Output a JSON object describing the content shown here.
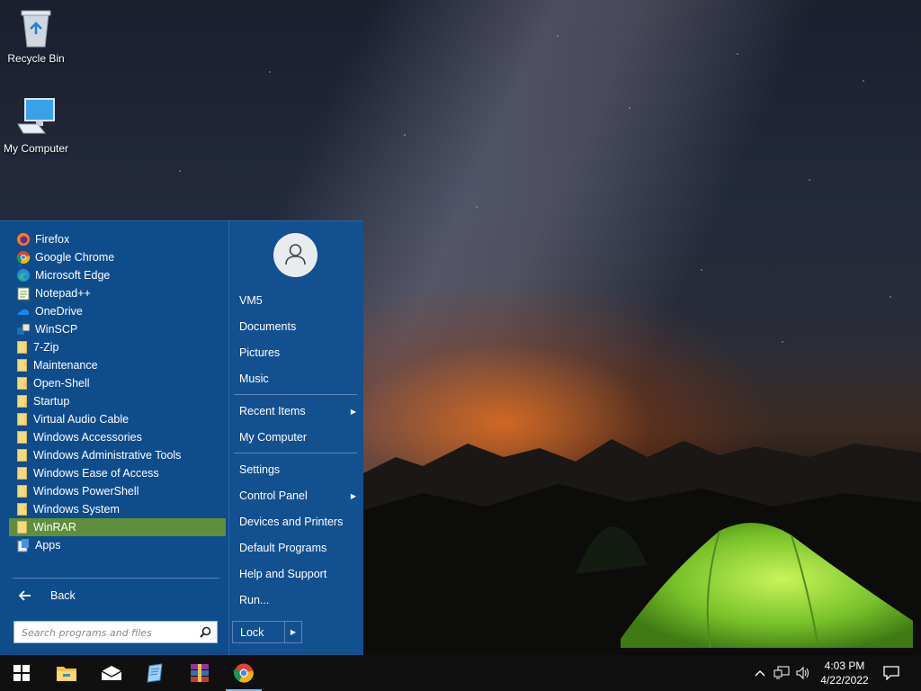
{
  "desktop": {
    "icons": [
      {
        "label": "Recycle Bin",
        "icon": "recycle-bin-icon"
      },
      {
        "label": "My Computer",
        "icon": "computer-icon"
      }
    ]
  },
  "start_menu": {
    "programs": [
      {
        "label": "Firefox",
        "icon": "firefox-icon"
      },
      {
        "label": "Google Chrome",
        "icon": "chrome-icon"
      },
      {
        "label": "Microsoft Edge",
        "icon": "edge-icon"
      },
      {
        "label": "Notepad++",
        "icon": "notepadpp-icon"
      },
      {
        "label": "OneDrive",
        "icon": "onedrive-icon"
      },
      {
        "label": "WinSCP",
        "icon": "winscp-icon"
      },
      {
        "label": "7-Zip",
        "icon": "folder-icon"
      },
      {
        "label": "Maintenance",
        "icon": "folder-icon"
      },
      {
        "label": "Open-Shell",
        "icon": "folder-icon"
      },
      {
        "label": "Startup",
        "icon": "folder-icon"
      },
      {
        "label": "Virtual Audio Cable",
        "icon": "folder-icon"
      },
      {
        "label": "Windows Accessories",
        "icon": "folder-icon"
      },
      {
        "label": "Windows Administrative Tools",
        "icon": "folder-icon"
      },
      {
        "label": "Windows Ease of Access",
        "icon": "folder-icon"
      },
      {
        "label": "Windows PowerShell",
        "icon": "folder-icon"
      },
      {
        "label": "Windows System",
        "icon": "folder-icon"
      },
      {
        "label": "WinRAR",
        "icon": "folder-icon",
        "selected": true
      },
      {
        "label": "Apps",
        "icon": "apps-icon"
      }
    ],
    "back_label": "Back",
    "search_placeholder": "Search programs and files",
    "right": {
      "user": "VM5",
      "documents": "Documents",
      "pictures": "Pictures",
      "music": "Music",
      "recent_items": "Recent Items",
      "my_computer": "My Computer",
      "settings": "Settings",
      "control_panel": "Control Panel",
      "devices_printers": "Devices and Printers",
      "default_programs": "Default Programs",
      "help_support": "Help and Support",
      "run": "Run...",
      "lock": "Lock"
    }
  },
  "taskbar": {
    "pinned": [
      "start-icon",
      "file-explorer-icon",
      "mail-icon",
      "notepad-icon",
      "winrar-icon",
      "chrome-icon"
    ],
    "active": "chrome-icon",
    "clock_time": "4:03 PM",
    "clock_date": "4/22/2022"
  },
  "colors": {
    "menu_bg": "#0f4c8c",
    "selected": "#5f8f3c",
    "taskbar": "#101010"
  }
}
